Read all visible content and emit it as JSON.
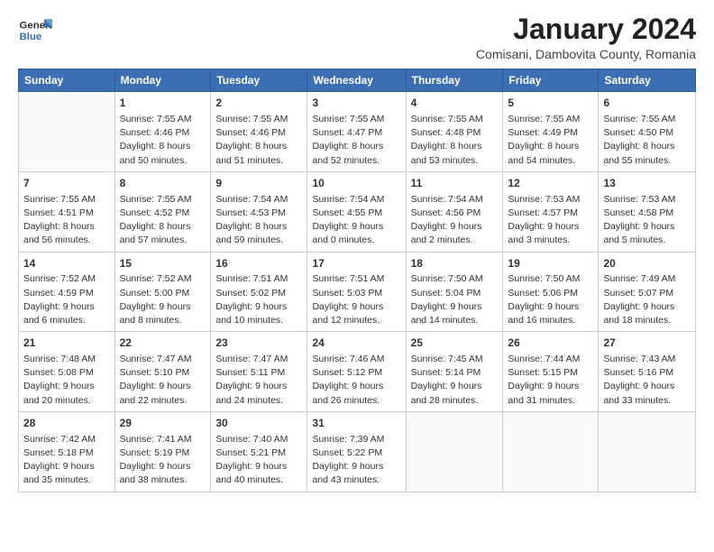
{
  "header": {
    "logo_line1": "General",
    "logo_line2": "Blue",
    "month_title": "January 2024",
    "location": "Comisani, Dambovita County, Romania"
  },
  "days_of_week": [
    "Sunday",
    "Monday",
    "Tuesday",
    "Wednesday",
    "Thursday",
    "Friday",
    "Saturday"
  ],
  "weeks": [
    [
      {
        "day": "",
        "info": ""
      },
      {
        "day": "1",
        "info": "Sunrise: 7:55 AM\nSunset: 4:46 PM\nDaylight: 8 hours\nand 50 minutes."
      },
      {
        "day": "2",
        "info": "Sunrise: 7:55 AM\nSunset: 4:46 PM\nDaylight: 8 hours\nand 51 minutes."
      },
      {
        "day": "3",
        "info": "Sunrise: 7:55 AM\nSunset: 4:47 PM\nDaylight: 8 hours\nand 52 minutes."
      },
      {
        "day": "4",
        "info": "Sunrise: 7:55 AM\nSunset: 4:48 PM\nDaylight: 8 hours\nand 53 minutes."
      },
      {
        "day": "5",
        "info": "Sunrise: 7:55 AM\nSunset: 4:49 PM\nDaylight: 8 hours\nand 54 minutes."
      },
      {
        "day": "6",
        "info": "Sunrise: 7:55 AM\nSunset: 4:50 PM\nDaylight: 8 hours\nand 55 minutes."
      }
    ],
    [
      {
        "day": "7",
        "info": "Sunrise: 7:55 AM\nSunset: 4:51 PM\nDaylight: 8 hours\nand 56 minutes."
      },
      {
        "day": "8",
        "info": "Sunrise: 7:55 AM\nSunset: 4:52 PM\nDaylight: 8 hours\nand 57 minutes."
      },
      {
        "day": "9",
        "info": "Sunrise: 7:54 AM\nSunset: 4:53 PM\nDaylight: 8 hours\nand 59 minutes."
      },
      {
        "day": "10",
        "info": "Sunrise: 7:54 AM\nSunset: 4:55 PM\nDaylight: 9 hours\nand 0 minutes."
      },
      {
        "day": "11",
        "info": "Sunrise: 7:54 AM\nSunset: 4:56 PM\nDaylight: 9 hours\nand 2 minutes."
      },
      {
        "day": "12",
        "info": "Sunrise: 7:53 AM\nSunset: 4:57 PM\nDaylight: 9 hours\nand 3 minutes."
      },
      {
        "day": "13",
        "info": "Sunrise: 7:53 AM\nSunset: 4:58 PM\nDaylight: 9 hours\nand 5 minutes."
      }
    ],
    [
      {
        "day": "14",
        "info": "Sunrise: 7:52 AM\nSunset: 4:59 PM\nDaylight: 9 hours\nand 6 minutes."
      },
      {
        "day": "15",
        "info": "Sunrise: 7:52 AM\nSunset: 5:00 PM\nDaylight: 9 hours\nand 8 minutes."
      },
      {
        "day": "16",
        "info": "Sunrise: 7:51 AM\nSunset: 5:02 PM\nDaylight: 9 hours\nand 10 minutes."
      },
      {
        "day": "17",
        "info": "Sunrise: 7:51 AM\nSunset: 5:03 PM\nDaylight: 9 hours\nand 12 minutes."
      },
      {
        "day": "18",
        "info": "Sunrise: 7:50 AM\nSunset: 5:04 PM\nDaylight: 9 hours\nand 14 minutes."
      },
      {
        "day": "19",
        "info": "Sunrise: 7:50 AM\nSunset: 5:06 PM\nDaylight: 9 hours\nand 16 minutes."
      },
      {
        "day": "20",
        "info": "Sunrise: 7:49 AM\nSunset: 5:07 PM\nDaylight: 9 hours\nand 18 minutes."
      }
    ],
    [
      {
        "day": "21",
        "info": "Sunrise: 7:48 AM\nSunset: 5:08 PM\nDaylight: 9 hours\nand 20 minutes."
      },
      {
        "day": "22",
        "info": "Sunrise: 7:47 AM\nSunset: 5:10 PM\nDaylight: 9 hours\nand 22 minutes."
      },
      {
        "day": "23",
        "info": "Sunrise: 7:47 AM\nSunset: 5:11 PM\nDaylight: 9 hours\nand 24 minutes."
      },
      {
        "day": "24",
        "info": "Sunrise: 7:46 AM\nSunset: 5:12 PM\nDaylight: 9 hours\nand 26 minutes."
      },
      {
        "day": "25",
        "info": "Sunrise: 7:45 AM\nSunset: 5:14 PM\nDaylight: 9 hours\nand 28 minutes."
      },
      {
        "day": "26",
        "info": "Sunrise: 7:44 AM\nSunset: 5:15 PM\nDaylight: 9 hours\nand 31 minutes."
      },
      {
        "day": "27",
        "info": "Sunrise: 7:43 AM\nSunset: 5:16 PM\nDaylight: 9 hours\nand 33 minutes."
      }
    ],
    [
      {
        "day": "28",
        "info": "Sunrise: 7:42 AM\nSunset: 5:18 PM\nDaylight: 9 hours\nand 35 minutes."
      },
      {
        "day": "29",
        "info": "Sunrise: 7:41 AM\nSunset: 5:19 PM\nDaylight: 9 hours\nand 38 minutes."
      },
      {
        "day": "30",
        "info": "Sunrise: 7:40 AM\nSunset: 5:21 PM\nDaylight: 9 hours\nand 40 minutes."
      },
      {
        "day": "31",
        "info": "Sunrise: 7:39 AM\nSunset: 5:22 PM\nDaylight: 9 hours\nand 43 minutes."
      },
      {
        "day": "",
        "info": ""
      },
      {
        "day": "",
        "info": ""
      },
      {
        "day": "",
        "info": ""
      }
    ]
  ]
}
